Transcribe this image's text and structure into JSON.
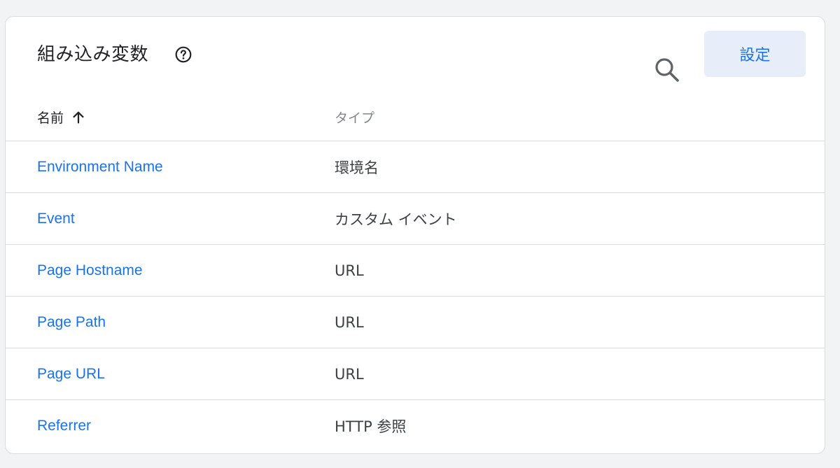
{
  "header": {
    "title": "組み込み変数",
    "settings_label": "設定"
  },
  "columns": {
    "name": "名前",
    "type": "タイプ"
  },
  "rows": [
    {
      "name": "Environment Name",
      "type": "環境名"
    },
    {
      "name": "Event",
      "type": "カスタム イベント"
    },
    {
      "name": "Page Hostname",
      "type": "URL"
    },
    {
      "name": "Page Path",
      "type": "URL"
    },
    {
      "name": "Page URL",
      "type": "URL"
    },
    {
      "name": "Referrer",
      "type": "HTTP 参照"
    }
  ],
  "icons": {
    "help": "help-circle-icon",
    "search": "search-icon",
    "sort": "arrow-up-icon"
  },
  "colors": {
    "link": "#1a73e8",
    "button_bg": "#e8eef9",
    "page_bg": "#f1f3f4"
  }
}
